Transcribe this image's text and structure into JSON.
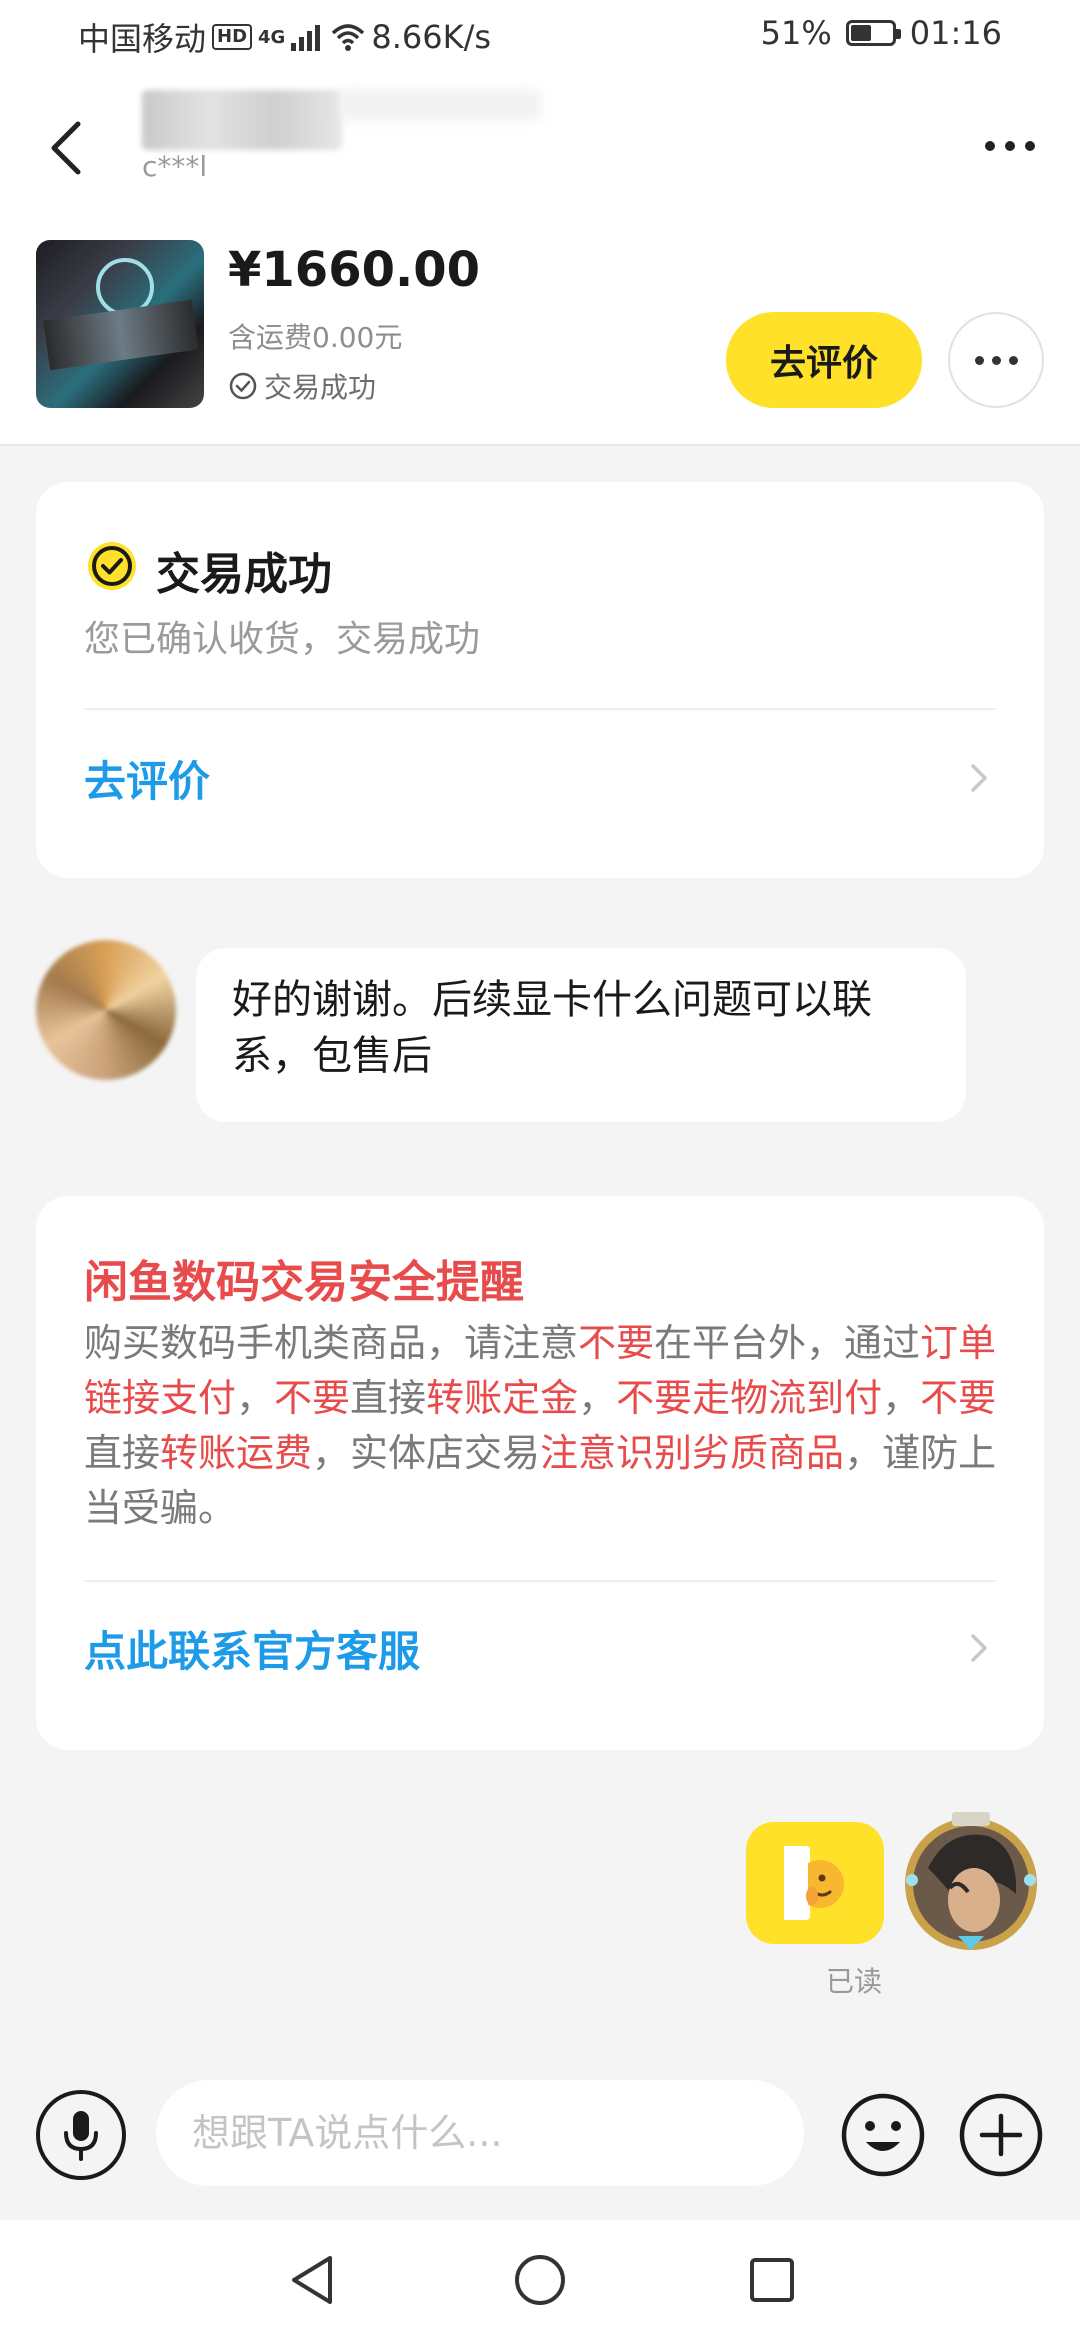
{
  "status_bar": {
    "carrier": "中国移动",
    "hd_badge": "HD",
    "network": "4G",
    "speed": "8.66K/s",
    "battery_percent": "51%",
    "battery_level": 0.51,
    "time": "01:16"
  },
  "header": {
    "seller_sub": "c***l",
    "icons": {
      "back": "back-arrow-icon",
      "more": "more-dots-icon"
    }
  },
  "product": {
    "price": "¥1660.00",
    "shipping": "含运费0.00元",
    "status": "交易成功",
    "review_button": "去评价"
  },
  "trade_card": {
    "title": "交易成功",
    "subtitle": "您已确认收货，交易成功",
    "link": "去评价"
  },
  "messages": {
    "incoming_text": "好的谢谢。后续显卡什么问题可以联系，包售后",
    "read_label": "已读"
  },
  "safety_card": {
    "title": "闲鱼数码交易安全提醒",
    "segments": [
      {
        "text": "购买数码手机类商品，请注意",
        "hl": false
      },
      {
        "text": "不要",
        "hl": true
      },
      {
        "text": "在平台外，通过",
        "hl": false
      },
      {
        "text": "订单链接支付",
        "hl": true
      },
      {
        "text": "，",
        "hl": false
      },
      {
        "text": "不要",
        "hl": true
      },
      {
        "text": "直接",
        "hl": false
      },
      {
        "text": "转账定金",
        "hl": true
      },
      {
        "text": "，",
        "hl": false
      },
      {
        "text": "不要走物流到付",
        "hl": true
      },
      {
        "text": "，",
        "hl": false
      },
      {
        "text": "不要",
        "hl": true
      },
      {
        "text": "直接",
        "hl": false
      },
      {
        "text": "转账运费",
        "hl": true
      },
      {
        "text": "，实体店交易",
        "hl": false
      },
      {
        "text": "注意识别劣质商品",
        "hl": true
      },
      {
        "text": "，谨防上当受骗。",
        "hl": false
      }
    ],
    "link": "点此联系官方客服"
  },
  "input_bar": {
    "placeholder": "想跟TA说点什么..."
  },
  "colors": {
    "accent_yellow": "#ffe12a",
    "link_blue": "#1e9be8",
    "warning_red": "#e84b4b",
    "background": "#f4f4f4"
  }
}
